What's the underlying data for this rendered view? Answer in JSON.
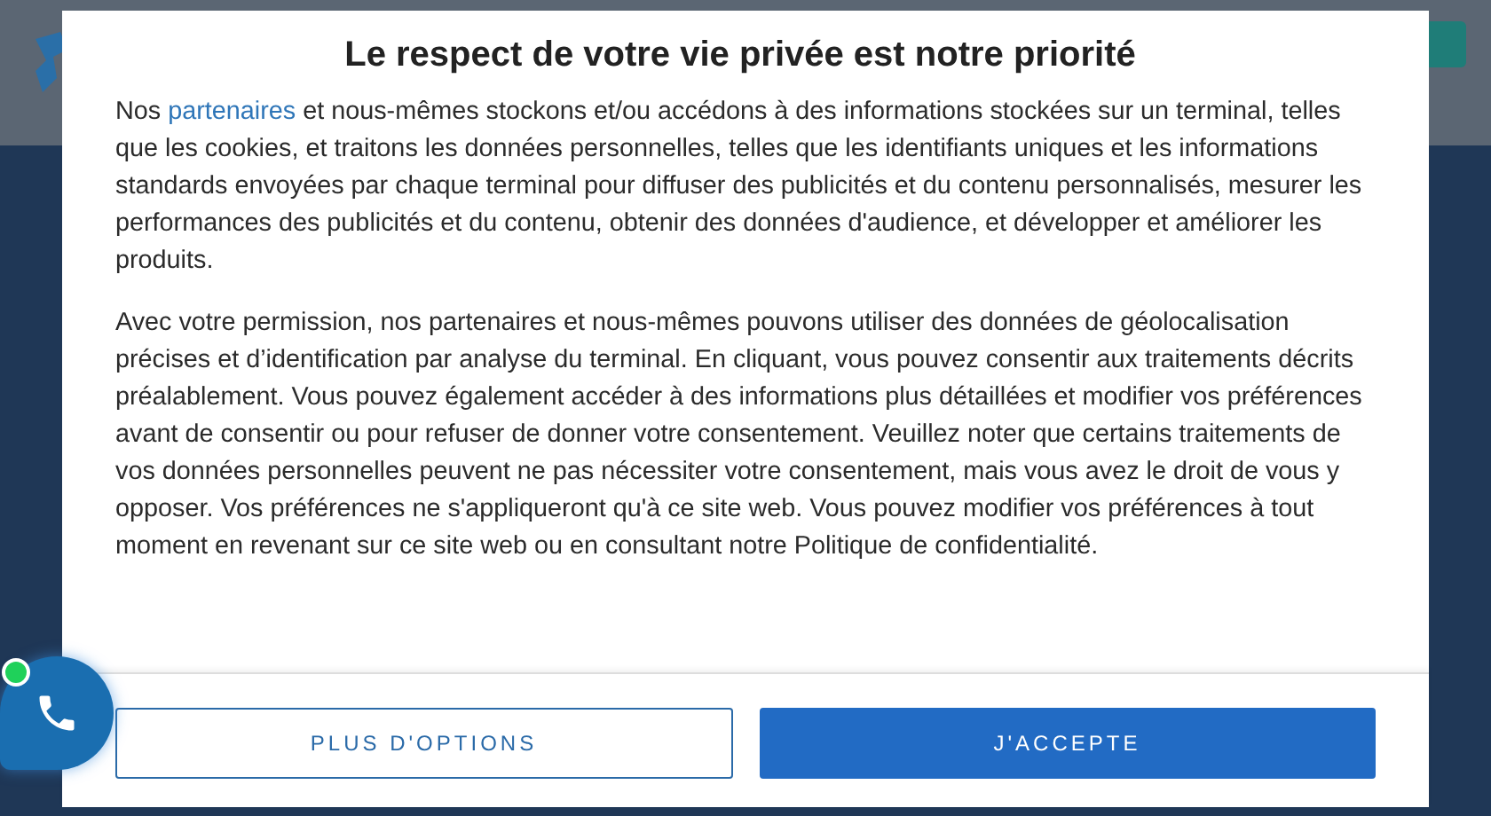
{
  "consent_dialog": {
    "title": "Le respect de votre vie privée est notre priorité",
    "intro": {
      "before": "Nos",
      "link": "partenaires",
      "after": "et nous-mêmes stockons et/ou accédons à des informations stockées sur un terminal, telles que les cookies, et traitons les données personnelles, telles que les identifiants uniques et les informations standards envoyées par chaque terminal pour diffuser des publicités et du contenu personnalisés, mesurer les performances des publicités et du contenu, obtenir des données d'audience, et développer et améliorer les produits."
    },
    "paragraphs": [
      "Avec votre permission, nos partenaires et nous-mêmes pouvons utiliser des données de géolocalisation précises et d’identification par analyse du terminal. En cliquant, vous pouvez consentir aux traitements décrits préalablement. Vous pouvez également accéder à des informations plus détaillées et modifier vos préférences avant de consentir ou pour refuser de donner votre consentement. Veuillez noter que certains traitements de vos données personnelles peuvent ne pas nécessiter votre consentement, mais vous avez le droit de vous y opposer. Vos préférences ne s'appliqueront qu'à ce site web. Vous pouvez modifier vos préférences à tout moment en revenant sur ce site web ou en consultant notre Politique de confidentialité."
    ],
    "buttons": [
      {
        "label": "PLUS D'OPTIONS",
        "kind": "secondary"
      },
      {
        "label": "J'ACCEPTE",
        "kind": "primary"
      }
    ]
  },
  "call_widget": {
    "online": true
  }
}
